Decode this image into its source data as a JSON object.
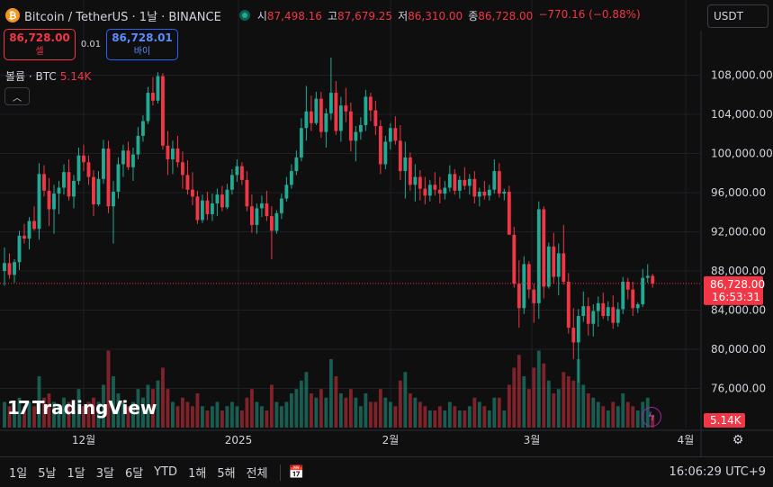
{
  "header": {
    "coin_icon": "bitcoin-icon",
    "symbol": "Bitcoin / TetherUS · 1날 · BINANCE",
    "open_label": "시",
    "open": "87,498.16",
    "high_label": "고",
    "high": "87,679.25",
    "low_label": "저",
    "low": "86,310.00",
    "close_label": "종",
    "close": "86,728.00",
    "change": "−770.16 (−0.88%)"
  },
  "currency": "USDT",
  "trade": {
    "sell_price": "86,728.00",
    "sell_label": "셀",
    "spread": "0.01",
    "buy_price": "86,728.01",
    "buy_label": "바이"
  },
  "volume_legend": {
    "label": "볼륨 · BTC",
    "value": "5.14K"
  },
  "logo_text": "TradingView",
  "price_axis": {
    "ticks": [
      "108,000.00",
      "104,000.00",
      "100,000.00",
      "96,000.00",
      "92,000.00",
      "88,000.00",
      "84,000.00",
      "80,000.00",
      "76,000.00"
    ],
    "last_price": "86,728.00",
    "countdown": "16:53:31",
    "volume_tag": "5.14K"
  },
  "time_axis": {
    "ticks": [
      "12월",
      "2025",
      "2월",
      "3월",
      "4월"
    ]
  },
  "ranges": [
    "1일",
    "5날",
    "1달",
    "3달",
    "6달",
    "YTD",
    "1해",
    "5해",
    "전체"
  ],
  "clock": "16:06:29 UTC+9",
  "colors": {
    "up": "#22ab94",
    "down": "#f23645",
    "background": "#0f0f0f"
  },
  "chart_data": {
    "type": "candlestick",
    "ylim": [
      72000,
      112000
    ],
    "volume_scale_max": 20,
    "candles": [
      [
        88000,
        90400,
        86500,
        88800,
        6
      ],
      [
        88800,
        89800,
        87200,
        87600,
        5
      ],
      [
        87600,
        89200,
        86800,
        88900,
        4
      ],
      [
        88900,
        92100,
        88100,
        91600,
        7
      ],
      [
        91600,
        92800,
        90800,
        91300,
        5
      ],
      [
        91300,
        93500,
        90200,
        93100,
        6
      ],
      [
        93100,
        94600,
        92100,
        92300,
        5
      ],
      [
        92300,
        99000,
        91200,
        97900,
        12
      ],
      [
        97900,
        98800,
        95600,
        96200,
        7
      ],
      [
        96200,
        97500,
        92600,
        94300,
        8
      ],
      [
        94300,
        96800,
        91800,
        95900,
        6
      ],
      [
        95900,
        97200,
        93800,
        96500,
        5
      ],
      [
        96500,
        98900,
        95800,
        98100,
        7
      ],
      [
        98100,
        99400,
        95200,
        95600,
        6
      ],
      [
        95600,
        97800,
        94400,
        97200,
        4
      ],
      [
        97200,
        100600,
        96800,
        99800,
        9
      ],
      [
        99800,
        100900,
        98200,
        99100,
        5
      ],
      [
        99100,
        99800,
        96800,
        97600,
        6
      ],
      [
        97600,
        98300,
        93600,
        94800,
        7
      ],
      [
        94800,
        98200,
        94600,
        97400,
        6
      ],
      [
        97400,
        101400,
        96900,
        100500,
        10
      ],
      [
        100500,
        101300,
        93900,
        94600,
        18
      ],
      [
        94600,
        97200,
        90800,
        96100,
        12
      ],
      [
        96100,
        99600,
        95400,
        98900,
        8
      ],
      [
        98900,
        100900,
        97600,
        100300,
        6
      ],
      [
        100300,
        101200,
        98300,
        98600,
        5
      ],
      [
        98600,
        100600,
        97200,
        99900,
        6
      ],
      [
        99900,
        102700,
        99400,
        101800,
        9
      ],
      [
        101800,
        103900,
        101200,
        103300,
        7
      ],
      [
        103300,
        106800,
        103000,
        106200,
        10
      ],
      [
        106200,
        107800,
        104900,
        105400,
        9
      ],
      [
        105400,
        108300,
        105100,
        107900,
        11
      ],
      [
        107900,
        108200,
        100400,
        100800,
        14
      ],
      [
        100800,
        102300,
        97800,
        99400,
        9
      ],
      [
        99400,
        101300,
        97900,
        100500,
        6
      ],
      [
        100500,
        101800,
        98600,
        99100,
        5
      ],
      [
        99100,
        100200,
        96400,
        97800,
        7
      ],
      [
        97800,
        99300,
        95800,
        96300,
        6
      ],
      [
        96300,
        98100,
        94700,
        95600,
        5
      ],
      [
        95600,
        96200,
        92800,
        93200,
        8
      ],
      [
        93200,
        95800,
        92900,
        95200,
        5
      ],
      [
        95200,
        96100,
        93200,
        93800,
        4
      ],
      [
        93800,
        95900,
        93100,
        94900,
        5
      ],
      [
        94900,
        96400,
        93600,
        95800,
        6
      ],
      [
        95800,
        96700,
        94100,
        94500,
        4
      ],
      [
        94500,
        96900,
        94300,
        96300,
        5
      ],
      [
        96300,
        98400,
        95800,
        97800,
        6
      ],
      [
        97800,
        99400,
        97100,
        98700,
        5
      ],
      [
        98700,
        99100,
        96800,
        97300,
        4
      ],
      [
        97300,
        98200,
        94100,
        94600,
        7
      ],
      [
        94600,
        95800,
        91900,
        92700,
        9
      ],
      [
        92700,
        94900,
        91800,
        94400,
        6
      ],
      [
        94400,
        95700,
        93500,
        94900,
        5
      ],
      [
        94900,
        96200,
        93100,
        93600,
        4
      ],
      [
        93600,
        94600,
        89200,
        92100,
        10
      ],
      [
        92100,
        94200,
        91800,
        93900,
        6
      ],
      [
        93900,
        95900,
        93300,
        95400,
        5
      ],
      [
        95400,
        97600,
        95100,
        96800,
        6
      ],
      [
        96800,
        98900,
        96400,
        98200,
        8
      ],
      [
        98200,
        100300,
        97800,
        99600,
        9
      ],
      [
        99600,
        103600,
        99200,
        102600,
        11
      ],
      [
        102600,
        106900,
        101300,
        104300,
        13
      ],
      [
        104300,
        105900,
        102300,
        103100,
        8
      ],
      [
        103100,
        106300,
        102900,
        105600,
        7
      ],
      [
        105600,
        106300,
        101600,
        102200,
        9
      ],
      [
        102200,
        104600,
        100600,
        104100,
        7
      ],
      [
        104100,
        109800,
        103400,
        106200,
        16
      ],
      [
        106200,
        107400,
        101900,
        102300,
        12
      ],
      [
        102300,
        105800,
        101200,
        104900,
        8
      ],
      [
        104900,
        106700,
        103200,
        104300,
        7
      ],
      [
        104300,
        105200,
        100200,
        101300,
        9
      ],
      [
        101300,
        102800,
        99200,
        102200,
        7
      ],
      [
        102200,
        103700,
        101400,
        102900,
        5
      ],
      [
        102900,
        106500,
        102300,
        105800,
        8
      ],
      [
        105800,
        106200,
        103300,
        104400,
        6
      ],
      [
        104400,
        105400,
        101900,
        102800,
        6
      ],
      [
        102800,
        103400,
        97900,
        98900,
        9
      ],
      [
        98900,
        101800,
        98400,
        101200,
        7
      ],
      [
        101200,
        103100,
        100400,
        102600,
        6
      ],
      [
        102600,
        103800,
        100900,
        101300,
        5
      ],
      [
        101300,
        102900,
        97300,
        98200,
        11
      ],
      [
        98200,
        101200,
        95400,
        99600,
        13
      ],
      [
        99600,
        100100,
        96200,
        96800,
        8
      ],
      [
        96800,
        98900,
        95100,
        97600,
        7
      ],
      [
        97600,
        98300,
        95200,
        96400,
        6
      ],
      [
        96400,
        97600,
        94800,
        95700,
        5
      ],
      [
        95700,
        97300,
        95100,
        96800,
        4
      ],
      [
        96800,
        98100,
        95700,
        96300,
        4
      ],
      [
        96300,
        97600,
        94900,
        95900,
        5
      ],
      [
        95900,
        97200,
        95300,
        96500,
        4
      ],
      [
        96500,
        98800,
        96100,
        97900,
        6
      ],
      [
        97900,
        98400,
        95800,
        96200,
        5
      ],
      [
        96200,
        97700,
        95400,
        97300,
        4
      ],
      [
        97300,
        98600,
        96300,
        96700,
        4
      ],
      [
        96700,
        97900,
        95800,
        97400,
        5
      ],
      [
        97400,
        98200,
        94900,
        95600,
        7
      ],
      [
        95600,
        96500,
        94600,
        96100,
        6
      ],
      [
        96100,
        97200,
        95300,
        95700,
        5
      ],
      [
        95700,
        96800,
        95200,
        96300,
        4
      ],
      [
        96300,
        99400,
        95900,
        98200,
        7
      ],
      [
        98200,
        99000,
        95500,
        95900,
        7
      ],
      [
        95900,
        96400,
        95200,
        96100,
        4
      ],
      [
        96100,
        96700,
        92400,
        91700,
        10
      ],
      [
        91700,
        92500,
        86300,
        86700,
        14
      ],
      [
        86700,
        89100,
        82200,
        84200,
        17
      ],
      [
        84200,
        89500,
        83600,
        88700,
        12
      ],
      [
        88700,
        89000,
        85200,
        86100,
        9
      ],
      [
        86100,
        86700,
        82700,
        84700,
        14
      ],
      [
        84700,
        95100,
        83100,
        94300,
        18
      ],
      [
        94300,
        94600,
        85200,
        86400,
        15
      ],
      [
        86400,
        90900,
        86200,
        90500,
        11
      ],
      [
        90500,
        91900,
        86700,
        87400,
        8
      ],
      [
        87400,
        90800,
        85500,
        89800,
        9
      ],
      [
        89800,
        92700,
        86600,
        86900,
        13
      ],
      [
        86900,
        87800,
        81600,
        82200,
        12
      ],
      [
        82200,
        84200,
        79000,
        80700,
        11
      ],
      [
        80700,
        84100,
        76600,
        83400,
        16
      ],
      [
        83400,
        85900,
        82800,
        84400,
        10
      ],
      [
        84400,
        85300,
        81400,
        82600,
        8
      ],
      [
        82600,
        84600,
        81300,
        83900,
        7
      ],
      [
        83900,
        85400,
        82300,
        84700,
        6
      ],
      [
        84700,
        85800,
        83100,
        83400,
        5
      ],
      [
        83400,
        84900,
        82900,
        84300,
        4
      ],
      [
        84300,
        85500,
        82100,
        82700,
        6
      ],
      [
        82700,
        84800,
        82300,
        84100,
        5
      ],
      [
        84100,
        87400,
        83600,
        86900,
        8
      ],
      [
        86900,
        87300,
        85100,
        86100,
        6
      ],
      [
        86100,
        86900,
        83400,
        84200,
        5
      ],
      [
        84200,
        84800,
        83700,
        84600,
        4
      ],
      [
        84600,
        88200,
        84300,
        87300,
        6
      ],
      [
        87300,
        88700,
        86800,
        87500,
        7
      ],
      [
        87500,
        87700,
        86300,
        86728,
        3
      ]
    ]
  }
}
